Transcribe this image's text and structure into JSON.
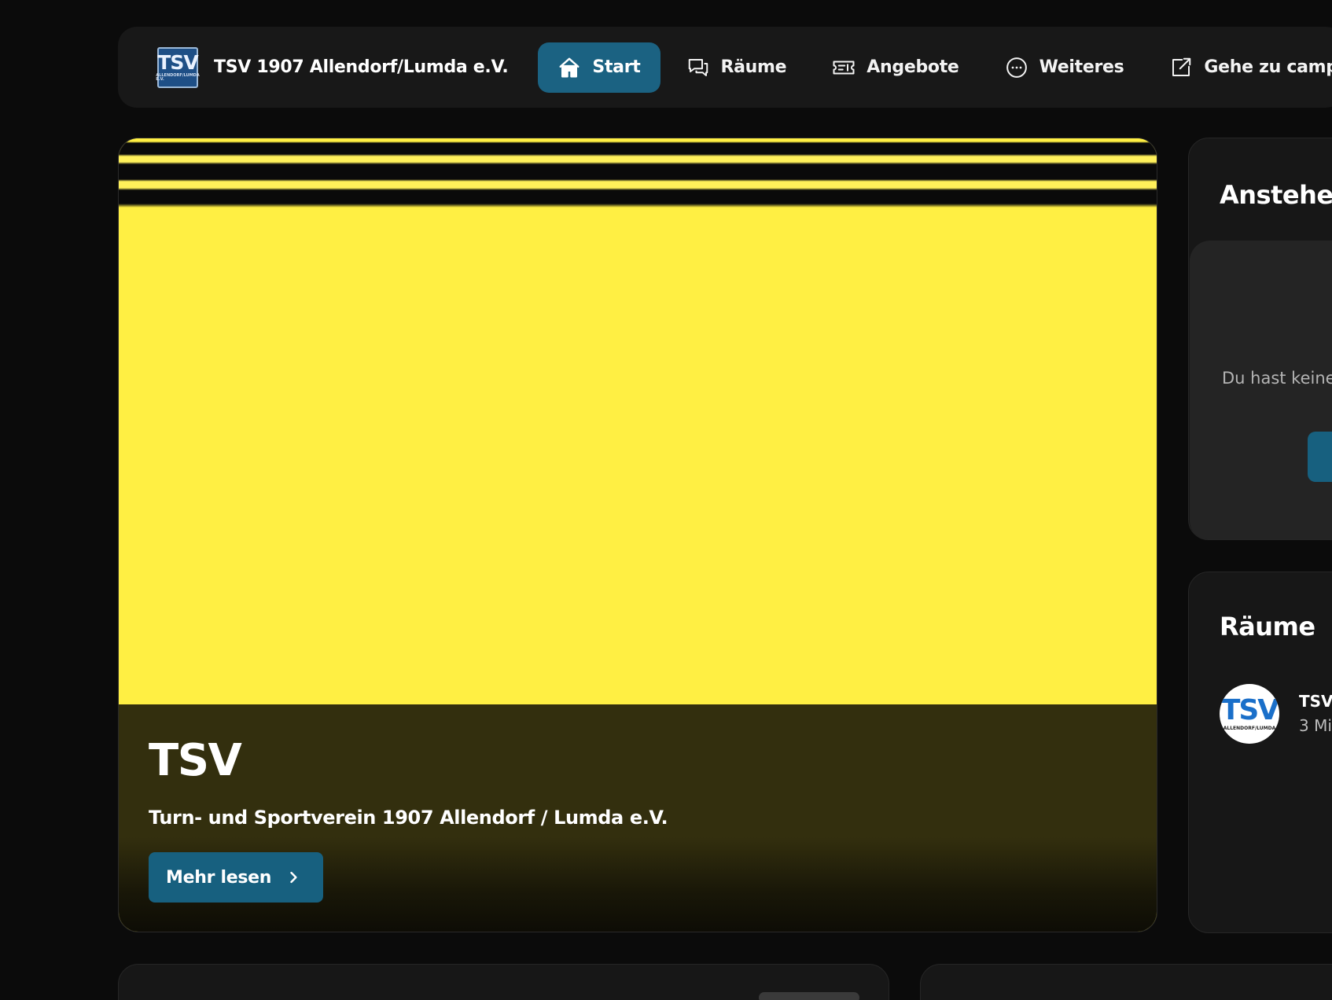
{
  "brand": {
    "name": "TSV 1907 Allendorf/Lumda e.V.",
    "logo_text": "TSV",
    "logo_subtext": "ALLENDORF/LUMDA E.V."
  },
  "nav": {
    "items": [
      {
        "label": "Start",
        "icon": "home-icon",
        "active": true
      },
      {
        "label": "Räume",
        "icon": "chat-bubbles-icon",
        "active": false
      },
      {
        "label": "Angebote",
        "icon": "ticket-icon",
        "active": false
      },
      {
        "label": "Weiteres",
        "icon": "more-circle-icon",
        "active": false
      },
      {
        "label": "Gehe zu campai",
        "icon": "external-link-icon",
        "active": false
      }
    ]
  },
  "hero": {
    "title": "TSV",
    "subtitle": "Turn- und Sportverein 1907 Allendorf / Lumda e.V.",
    "button_label": "Mehr lesen",
    "button_icon": "chevron-right-icon",
    "banner_color": "#ffef43"
  },
  "upcoming": {
    "title": "Anstehend",
    "empty_text": "Du hast keine"
  },
  "rooms": {
    "title": "Räume",
    "items": [
      {
        "name": "TSV",
        "meta": "3 Mi",
        "avatar_text": "TSV",
        "avatar_subtext": "ALLENDORF/LUMDA"
      }
    ]
  },
  "colors": {
    "accent": "#17607f",
    "background": "#0b0b0b",
    "card": "#171717",
    "banner_yellow": "#ffef43"
  }
}
